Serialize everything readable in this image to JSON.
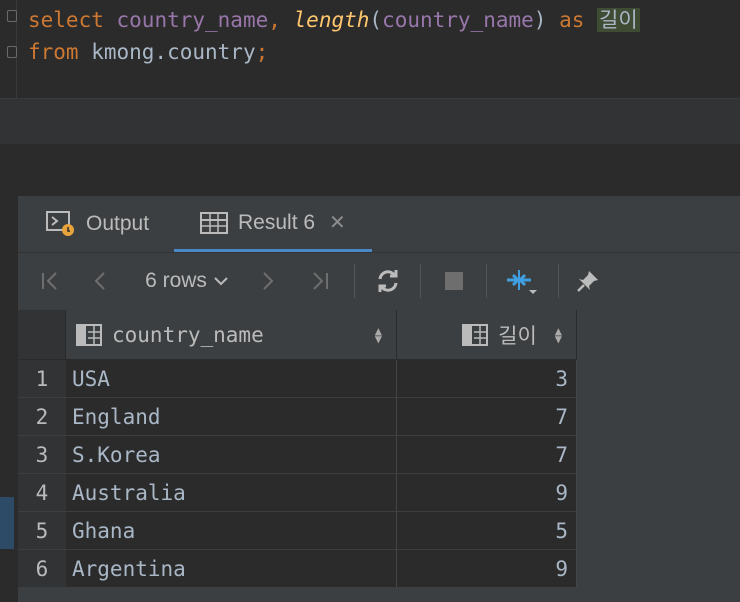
{
  "editor": {
    "line1": {
      "kw1": "select",
      "col1": "country_name",
      "comma": ", ",
      "fn": "length",
      "open": "(",
      "col2": "country_name",
      "close": ")",
      "kw2": " as ",
      "alias": "길이"
    },
    "line2": {
      "kw": "from",
      "table": " kmong.country",
      "semi": ";"
    }
  },
  "tabs": [
    {
      "label": "Output",
      "icon": "output-console-icon"
    },
    {
      "label": "Result 6",
      "icon": "table-grid-icon"
    }
  ],
  "toolbar": {
    "rows_label": "6 rows"
  },
  "grid": {
    "columns": [
      {
        "label": "country_name",
        "icon": "column-icon"
      },
      {
        "label": "길이",
        "icon": "column-icon"
      }
    ],
    "rows": [
      {
        "n": "1",
        "country": "USA",
        "len": "3"
      },
      {
        "n": "2",
        "country": "England",
        "len": "7"
      },
      {
        "n": "3",
        "country": "S.Korea",
        "len": "7"
      },
      {
        "n": "4",
        "country": "Australia",
        "len": "9"
      },
      {
        "n": "5",
        "country": "Ghana",
        "len": "5"
      },
      {
        "n": "6",
        "country": "Argentina",
        "len": "9"
      }
    ]
  },
  "colors": {
    "accent": "#4a88c7",
    "keyword": "#cc7832",
    "identifier": "#9876aa",
    "function": "#ffc66d"
  }
}
